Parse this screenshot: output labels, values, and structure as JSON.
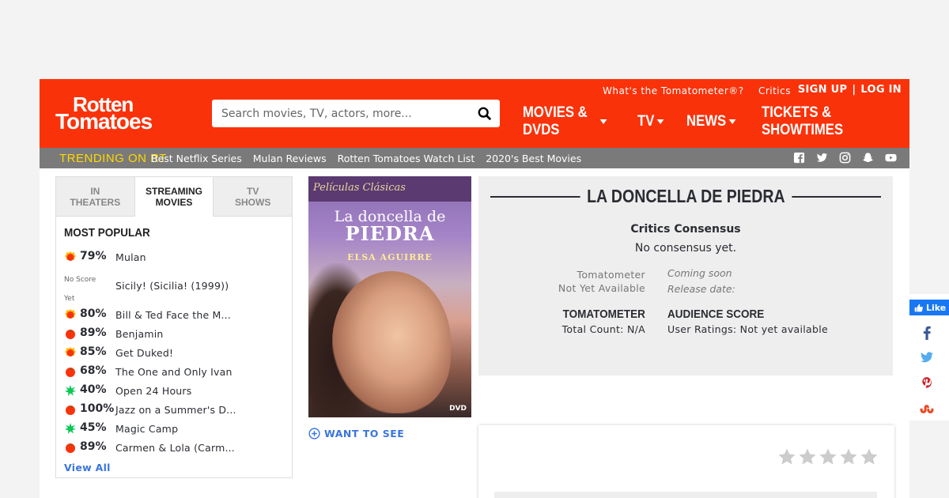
{
  "header": {
    "logo_line1": "Rotten",
    "logo_line2": "Tomatoes",
    "search_placeholder": "Search movies, TV, actors, more...",
    "top_links": [
      "What's the Tomatometer®?",
      "Critics"
    ],
    "sign_up": "SIGN UP",
    "separator": "|",
    "log_in": "LOG IN",
    "nav": [
      "MOVIES & DVDS",
      "TV",
      "NEWS",
      "TICKETS & SHOWTIMES"
    ]
  },
  "trending": {
    "label": "TRENDING ON RT",
    "links": [
      "Best Netflix Series",
      "Mulan Reviews",
      "Rotten Tomatoes Watch List",
      "2020's Best Movies"
    ]
  },
  "sidebar": {
    "tabs": [
      "IN\nTHEATERS",
      "STREAMING\nMOVIES",
      "TV\nSHOWS"
    ],
    "heading": "MOST POPULAR",
    "items": [
      {
        "icon": "certified-fresh",
        "score": "79%",
        "title": "Mulan"
      },
      {
        "icon": "none",
        "score": "No Score Yet",
        "title": "Sicily! (Sicilia! (1999))"
      },
      {
        "icon": "certified-fresh",
        "score": "80%",
        "title": "Bill & Ted Face the M..."
      },
      {
        "icon": "fresh",
        "score": "89%",
        "title": "Benjamin"
      },
      {
        "icon": "certified-fresh",
        "score": "85%",
        "title": "Get Duked!"
      },
      {
        "icon": "fresh",
        "score": "68%",
        "title": "The One and Only Ivan"
      },
      {
        "icon": "rotten",
        "score": "40%",
        "title": "Open 24 Hours"
      },
      {
        "icon": "fresh",
        "score": "100%",
        "title": "Jazz on a Summer's D..."
      },
      {
        "icon": "rotten",
        "score": "45%",
        "title": "Magic Camp"
      },
      {
        "icon": "fresh",
        "score": "89%",
        "title": "Carmen & Lola (Carm..."
      }
    ],
    "view_all": "View All"
  },
  "poster": {
    "series": "Películas Clásicas",
    "title_line1": "La doncella de",
    "title_line2": "PIEDRA",
    "actor": "ELSA AGUIRRE",
    "dvd": "DVD"
  },
  "want_to_see": "WANT TO SEE",
  "movie": {
    "title": "LA DONCELLA DE PIEDRA",
    "consensus_heading": "Critics Consensus",
    "consensus_text": "No consensus yet.",
    "tomatometer_label_1": "Tomatometer",
    "tomatometer_label_2": "Not Yet Available",
    "coming_soon": "Coming soon",
    "release_date": "Release date:",
    "tomatometer_heading": "TOMATOMETER",
    "total_count": "Total Count: N/A",
    "audience_heading": "AUDIENCE SCORE",
    "user_ratings": "User Ratings: Not yet available"
  },
  "rating": {
    "stars": 5
  },
  "facebook": {
    "like": "Like"
  },
  "colors": {
    "brand": "#fa320a",
    "trending_bar": "#7a7a7a",
    "trending_label": "#ffd700",
    "link": "#3976dc",
    "rotten": "#0ac855",
    "facebook": "#1877f2"
  }
}
